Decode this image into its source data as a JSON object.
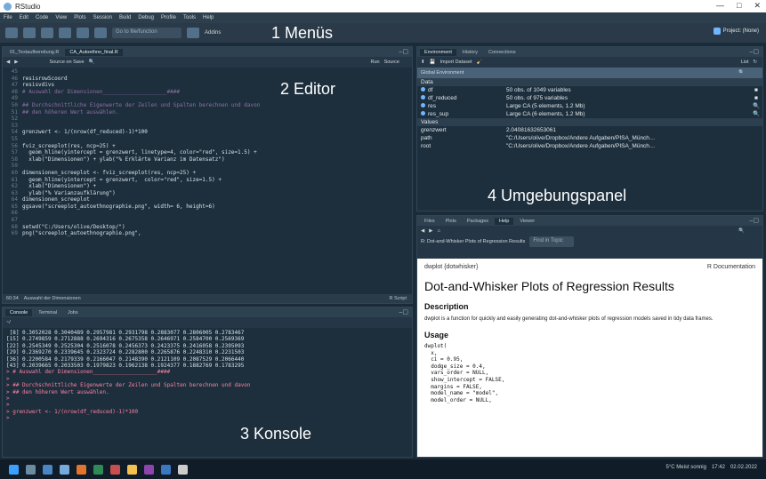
{
  "window": {
    "title": "RStudio",
    "controls": [
      "—",
      "□",
      "✕"
    ]
  },
  "menu": [
    "File",
    "Edit",
    "Code",
    "View",
    "Plots",
    "Session",
    "Build",
    "Debug",
    "Profile",
    "Tools",
    "Help"
  ],
  "toolbar": {
    "goto_placeholder": "Go to file/function",
    "addins_label": "Addins",
    "project_label": "Project: (None)"
  },
  "annotations": {
    "menus": "1 Menüs",
    "editor": "2 Editor",
    "console": "3 Konsole",
    "environment": "4 Umgebungspanel",
    "files": "5 Daten-, Grafik-, Paket-, Hilfe- und Viewer-Fenster"
  },
  "editor": {
    "tabs": [
      "01_Textaufbereitung.R",
      "CA_Autoethno_final.R"
    ],
    "source_on_save": "Source on Save",
    "run_label": "Run",
    "source_label": "Source",
    "lines": [
      {
        "n": "45",
        "t": "",
        "c": "tx"
      },
      {
        "n": "46",
        "t": "resisrowScoord",
        "c": "tx"
      },
      {
        "n": "47",
        "t": "resisvdivs",
        "c": "tx"
      },
      {
        "n": "48",
        "t": "# Auswahl der Dimensionen____________________####",
        "c": "tx comment"
      },
      {
        "n": "49",
        "t": "",
        "c": "tx"
      },
      {
        "n": "50",
        "t": "## Durchschnittliche Eigenwerte der Zeilen und Spalten berechnen und davon",
        "c": "tx comment"
      },
      {
        "n": "51",
        "t": "## den höheren Wert auswählen.",
        "c": "tx comment"
      },
      {
        "n": "52",
        "t": "",
        "c": "tx"
      },
      {
        "n": "53",
        "t": "",
        "c": "tx"
      },
      {
        "n": "54",
        "t": "grenzwert <- 1/(nrow(df_reduced)-1)*100",
        "c": "tx"
      },
      {
        "n": "55",
        "t": "",
        "c": "tx"
      },
      {
        "n": "56",
        "t": "fviz_screeplot(res, ncp=25) +",
        "c": "tx"
      },
      {
        "n": "57",
        "t": "  geom_hline(yintercept = grenzwert, linetype=4, color=\"red\", size=1.5) +",
        "c": "tx"
      },
      {
        "n": "58",
        "t": "  xlab(\"Dimensionen\") + ylab(\"% Erklärte Varianz im Datensatz\")",
        "c": "tx"
      },
      {
        "n": "59",
        "t": "",
        "c": "tx"
      },
      {
        "n": "60",
        "t": "dimensionen_screeplot <- fviz_screeplot(res, ncp=25) +",
        "c": "tx"
      },
      {
        "n": "61",
        "t": "  geom_hline(yintercept = grenzwert,  color=\"red\", size=1.5) +",
        "c": "tx"
      },
      {
        "n": "62",
        "t": "  xlab(\"Dimensionen\") +",
        "c": "tx"
      },
      {
        "n": "63",
        "t": "  ylab(\"% Varianzaufklärung\")",
        "c": "tx"
      },
      {
        "n": "64",
        "t": "dimensionen_screeplot",
        "c": "tx"
      },
      {
        "n": "65",
        "t": "ggsave(\"screeplot_autoethnographie.png\", width= 6, height=6)",
        "c": "tx"
      },
      {
        "n": "66",
        "t": "",
        "c": "tx"
      },
      {
        "n": "67",
        "t": "",
        "c": "tx"
      },
      {
        "n": "68",
        "t": "setwd(\"C:/Users/olive/Desktop/\")",
        "c": "tx"
      },
      {
        "n": "69",
        "t": "png(\"screeplot_autoethnographie.png\",",
        "c": "tx"
      }
    ],
    "status_pos": "60:34",
    "status_section": "Auswahl der Dimensionen",
    "status_type": "R Script"
  },
  "console": {
    "tabs": [
      "Console",
      "Terminal",
      "Jobs"
    ],
    "path": "~/",
    "lines": [
      {
        "t": " [8] 0.3052028 0.3040489 0.2957981 0.2931798 0.2883077 0.2806005 0.2783467",
        "c": "con-line"
      },
      {
        "t": "[15] 0.2749859 0.2712888 0.2694316 0.2675358 0.2646971 0.2584700 0.2569369",
        "c": "con-line"
      },
      {
        "t": "[22] 0.2545349 0.2525304 0.2516078 0.2456373 0.2423375 0.2416058 0.2395093",
        "c": "con-line"
      },
      {
        "t": "[29] 0.2369270 0.2339645 0.2323724 0.2282800 0.2265876 0.2248310 0.2231503",
        "c": "con-line"
      },
      {
        "t": "[36] 0.2200584 0.2179339 0.2166047 0.2148390 0.2121109 0.2087529 0.2066440",
        "c": "con-line"
      },
      {
        "t": "[43] 0.2039665 0.2033503 0.1979823 0.1962138 0.1924377 0.1882769 0.1783295",
        "c": "con-line"
      },
      {
        "t": "> # Auswahl der Dimensionen____________________####",
        "c": "con-line pink"
      },
      {
        "t": ">",
        "c": "con-line pink"
      },
      {
        "t": "> ## Durchschnittliche Eigenwerte der Zeilen und Spalten berechnen und davon",
        "c": "con-line pink"
      },
      {
        "t": "> ## den höheren Wert auswählen.",
        "c": "con-line pink"
      },
      {
        "t": ">",
        "c": "con-line pink"
      },
      {
        "t": ">",
        "c": "con-line pink"
      },
      {
        "t": "> grenzwert <- 1/(nrow(df_reduced)-1)*100",
        "c": "con-line pink"
      },
      {
        "t": ">",
        "c": "con-line pink"
      }
    ]
  },
  "environment": {
    "tabs": [
      "Environment",
      "History",
      "Connections"
    ],
    "import_label": "Import Dataset",
    "list_label": "List",
    "global_label": "Global Environment",
    "data_header": "Data",
    "values_header": "Values",
    "data": [
      {
        "name": "df",
        "val": "50 obs. of 1049 variables",
        "chk": "■"
      },
      {
        "name": "df_reduced",
        "val": "50 obs. of 975 variables",
        "chk": "■"
      },
      {
        "name": "res",
        "val": "Large CA (5 elements, 1.2 Mb)",
        "chk": "🔍"
      },
      {
        "name": "res_sup",
        "val": "Large CA (6 elements, 1.2 Mb)",
        "chk": "🔍"
      }
    ],
    "values": [
      {
        "name": "grenzwert",
        "val": "2.04081632653061"
      },
      {
        "name": "path",
        "val": "\"C:/Users/olive/Dropbox/Andere Aufgaben/PISA_Münch…"
      },
      {
        "name": "root",
        "val": "\"C:/Users/olive/Dropbox/Andere Aufgaben/PISA_Münch…"
      }
    ]
  },
  "files": {
    "tabs": [
      "Files",
      "Plots",
      "Packages",
      "Help",
      "Viewer"
    ],
    "crumb": "R: Dot-and-Whisker Plots of Regression Results",
    "find_placeholder": "Find in Topic",
    "help_fn": "dwplot {dotwhisker}",
    "help_doc": "R Documentation",
    "help_title": "Dot-and-Whisker Plots of Regression Results",
    "desc_h": "Description",
    "desc_p": "dwplot is a function for quickly and easily generating dot-and-whisker plots of regression models saved in tidy data frames.",
    "usage_h": "Usage",
    "usage_code": "dwplot(\n  x,\n  ci = 0.95,\n  dodge_size = 0.4,\n  vars_order = NULL,\n  show_intercept = FALSE,\n  margins = FALSE,\n  model_name = \"model\",\n  model_order = NULL,"
  },
  "taskbar": {
    "weather": "5°C Meist sonnig",
    "time": "17:42",
    "date": "02.02.2022"
  }
}
